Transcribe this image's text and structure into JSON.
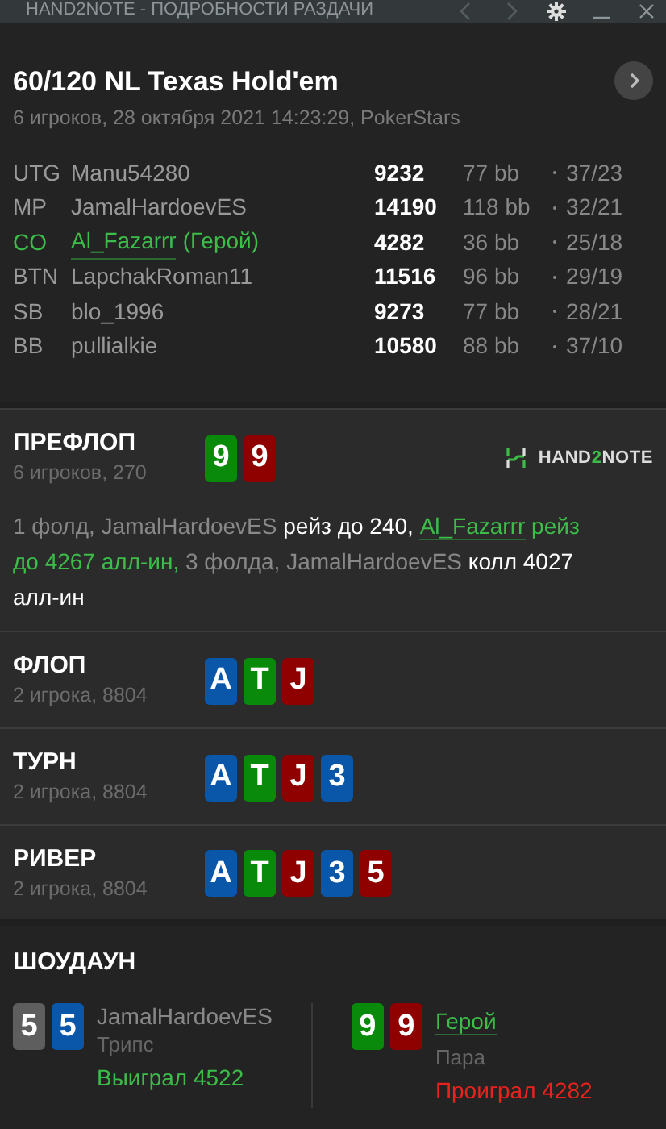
{
  "window": {
    "title": "HAND2NOTE - ПОДРОБНОСТИ РАЗДАЧИ"
  },
  "hand": {
    "title": "60/120 NL Texas Hold'em",
    "subtitle": "6 игроков, 28 октября 2021 14:23:29, PokerStars"
  },
  "players": [
    {
      "position": "UTG",
      "name": "Manu54280",
      "hero": false,
      "stack": "9232",
      "bb": "77 bb",
      "stat": "37/23"
    },
    {
      "position": "MP",
      "name": "JamalHardoevES",
      "hero": false,
      "stack": "14190",
      "bb": "118 bb",
      "stat": "32/21"
    },
    {
      "position": "CO",
      "name": "Al_Fazarrr",
      "hero": true,
      "hero_tag": "(Герой)",
      "stack": "4282",
      "bb": "36 bb",
      "stat": "25/18"
    },
    {
      "position": "BTN",
      "name": "LapchakRoman11",
      "hero": false,
      "stack": "11516",
      "bb": "96 bb",
      "stat": "29/19"
    },
    {
      "position": "SB",
      "name": "blo_1996",
      "hero": false,
      "stack": "9273",
      "bb": "77 bb",
      "stat": "28/21"
    },
    {
      "position": "BB",
      "name": "pullialkie",
      "hero": false,
      "stack": "10580",
      "bb": "88 bb",
      "stat": "37/10"
    }
  ],
  "logo": {
    "before": "HAND",
    "accent": "2",
    "after": "NOTE"
  },
  "streets": [
    {
      "name": "ПРЕФЛОП",
      "info": "6 игроков, 270",
      "cards": [
        {
          "rank": "9",
          "color": "#0a8a0a"
        },
        {
          "rank": "9",
          "color": "#8f0000"
        }
      ],
      "actions": [
        {
          "kind": "plain",
          "text": "1 фолд, JamalHardoevES "
        },
        {
          "kind": "action",
          "text": "рейз до 240, "
        },
        {
          "kind": "hero_link",
          "text": "Al_Fazarrr"
        },
        {
          "kind": "hero",
          "text": " рейз до 4267 алл-ин,"
        },
        {
          "kind": "plain",
          "text": " 3 фолда, JamalHardoevES "
        },
        {
          "kind": "action",
          "text": "колл 4027 алл-ин"
        }
      ]
    },
    {
      "name": "ФЛОП",
      "info": "2 игрока, 8804",
      "cards": [
        {
          "rank": "A",
          "color": "#0a56a8"
        },
        {
          "rank": "T",
          "color": "#0a8a0a"
        },
        {
          "rank": "J",
          "color": "#8f0000"
        }
      ]
    },
    {
      "name": "ТУРН",
      "info": "2 игрока, 8804",
      "cards": [
        {
          "rank": "A",
          "color": "#0a56a8"
        },
        {
          "rank": "T",
          "color": "#0a8a0a"
        },
        {
          "rank": "J",
          "color": "#8f0000"
        },
        {
          "rank": "3",
          "color": "#0a56a8"
        }
      ]
    },
    {
      "name": "РИВЕР",
      "info": "2 игрока, 8804",
      "cards": [
        {
          "rank": "A",
          "color": "#0a56a8"
        },
        {
          "rank": "T",
          "color": "#0a8a0a"
        },
        {
          "rank": "J",
          "color": "#8f0000"
        },
        {
          "rank": "3",
          "color": "#0a56a8"
        },
        {
          "rank": "5",
          "color": "#8f0000"
        }
      ]
    }
  ],
  "showdown": {
    "title": "ШОУДАУН",
    "hands": [
      {
        "cards": [
          {
            "rank": "5",
            "color": "#5e5e5e"
          },
          {
            "rank": "5",
            "color": "#0a56a8"
          }
        ],
        "name": "JamalHardoevES",
        "hero": false,
        "combo": "Трипс",
        "result": "Выиграл 4522",
        "won": true
      },
      {
        "cards": [
          {
            "rank": "9",
            "color": "#0a8a0a"
          },
          {
            "rank": "9",
            "color": "#8f0000"
          }
        ],
        "name": "Герой",
        "hero": true,
        "combo": "Пара",
        "result": "Проиграл 4282",
        "won": false
      }
    ]
  }
}
